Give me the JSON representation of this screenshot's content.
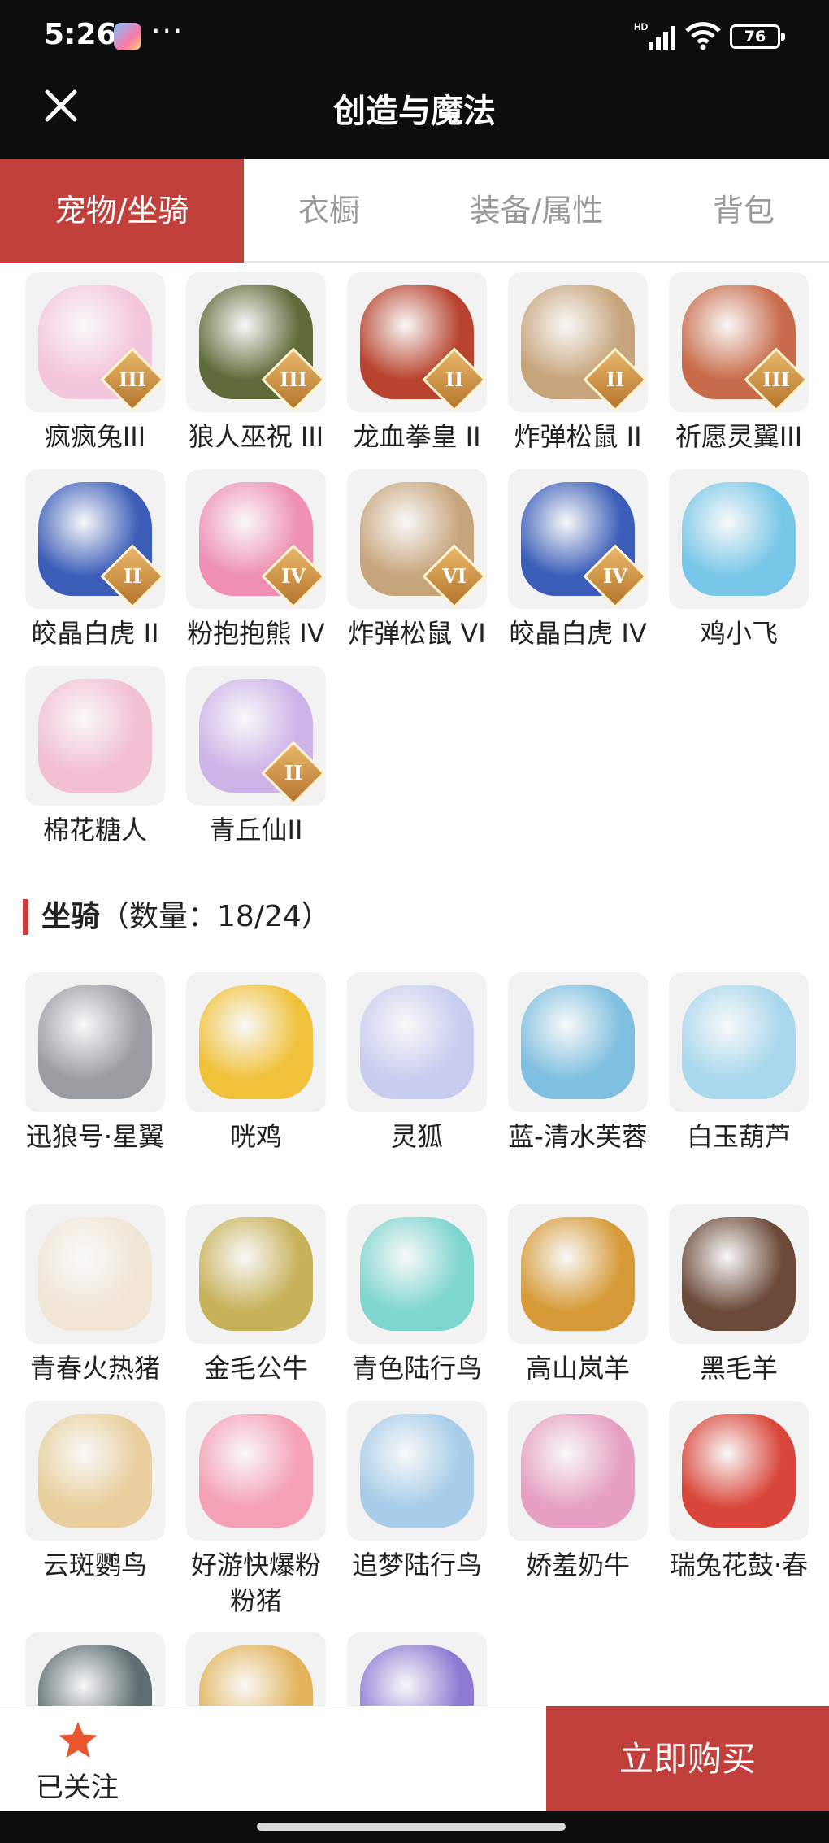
{
  "status_bar": {
    "time": "5:26",
    "more": "···",
    "signal_label": "HD",
    "battery": "76"
  },
  "header": {
    "title": "创造与魔法",
    "close_icon": "close-icon"
  },
  "tabs": [
    {
      "label": "宠物/坐骑",
      "active": true
    },
    {
      "label": "衣橱",
      "active": false
    },
    {
      "label": "装备/属性",
      "active": false
    },
    {
      "label": "背包",
      "active": false
    }
  ],
  "pets": [
    {
      "name": "疯疯兔III",
      "badge": "III",
      "color": "#f4c6dc"
    },
    {
      "name": "狼人巫祝 III",
      "badge": "III",
      "color": "#5f6b3a"
    },
    {
      "name": "龙血拳皇 II",
      "badge": "II",
      "color": "#b8432e"
    },
    {
      "name": "炸弹松鼠 II",
      "badge": "II",
      "color": "#c7a57c"
    },
    {
      "name": "祈愿灵翼III",
      "badge": "III",
      "color": "#c86b4a"
    },
    {
      "name": "皎晶白虎 II",
      "badge": "II",
      "color": "#3b5db8"
    },
    {
      "name": "粉抱抱熊 IV",
      "badge": "IV",
      "color": "#ee8fb3"
    },
    {
      "name": "炸弹松鼠 VI",
      "badge": "VI",
      "color": "#c7a57c"
    },
    {
      "name": "皎晶白虎 IV",
      "badge": "IV",
      "color": "#3b5db8"
    },
    {
      "name": "鸡小飞",
      "badge": "",
      "color": "#79c7e8"
    },
    {
      "name": "棉花糖人",
      "badge": "",
      "color": "#f2bfd3"
    },
    {
      "name": "青丘仙II",
      "badge": "II",
      "color": "#cdb3e8"
    }
  ],
  "mounts_section": {
    "title": "坐骑",
    "count": "（数量：18/24）"
  },
  "mounts": [
    {
      "name": "迅狼号·星翼",
      "color": "#9a9ea3"
    },
    {
      "name": "咣鸡",
      "color": "#f0c23a"
    },
    {
      "name": "灵狐",
      "color": "#c8cdef"
    },
    {
      "name": "蓝-清水芙蓉",
      "color": "#7fbfe0"
    },
    {
      "name": "白玉葫芦",
      "color": "#a9d7ec"
    },
    {
      "name": "青春火热猪",
      "color": "#f1e6d6"
    },
    {
      "name": "金毛公牛",
      "color": "#c7b25a"
    },
    {
      "name": "青色陆行鸟",
      "color": "#7fd6cf"
    },
    {
      "name": "高山岚羊",
      "color": "#d69b38"
    },
    {
      "name": "黑毛羊",
      "color": "#6b4a3a"
    },
    {
      "name": "云斑鹦鸟",
      "color": "#e8cf9d"
    },
    {
      "name": "好游快爆粉粉猪",
      "color": "#f4a0b5"
    },
    {
      "name": "追梦陆行鸟",
      "color": "#a7cde8"
    },
    {
      "name": "娇羞奶牛",
      "color": "#e5a0c2"
    },
    {
      "name": "瑞兔花鼓·春",
      "color": "#d9453a"
    },
    {
      "name": "",
      "color": "#5d6d70"
    },
    {
      "name": "",
      "color": "#e2b35a"
    },
    {
      "name": "",
      "color": "#8d7ad3"
    }
  ],
  "bottom_bar": {
    "follow_label": "已关注",
    "buy_label": "立即购买"
  }
}
